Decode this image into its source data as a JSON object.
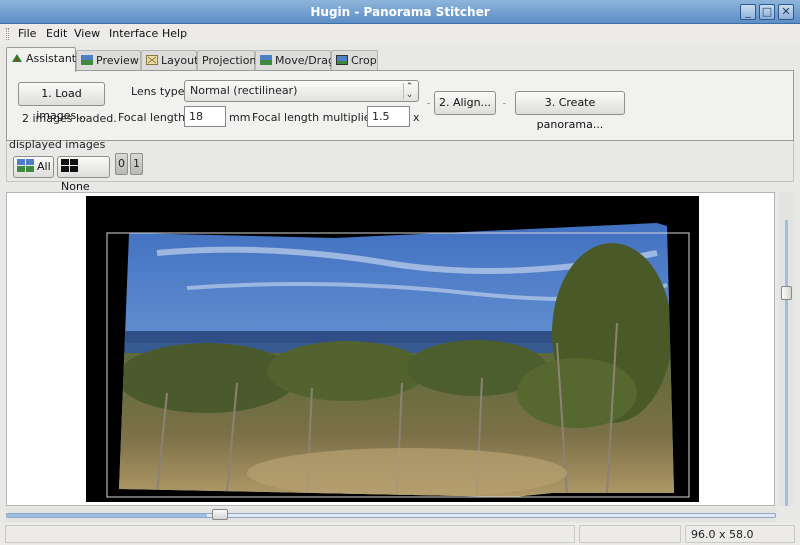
{
  "window": {
    "title": "Hugin - Panorama Stitcher",
    "controls": [
      "minimize-icon",
      "maximize-icon",
      "close-icon"
    ]
  },
  "menu": [
    "File",
    "Edit",
    "View",
    "Interface",
    "Help"
  ],
  "tabs": [
    {
      "label": "Assistant",
      "icon": "assistant-icon",
      "active": true
    },
    {
      "label": "Preview",
      "icon": "preview-icon",
      "active": false
    },
    {
      "label": "Layout",
      "icon": "layout-icon",
      "active": false
    },
    {
      "label": "Projection",
      "icon": "",
      "active": false
    },
    {
      "label": "Move/Drag",
      "icon": "move-drag-icon",
      "active": false
    },
    {
      "label": "Crop",
      "icon": "crop-icon",
      "active": false
    }
  ],
  "assistant": {
    "load_button": "1. Load images...",
    "status": "2 images loaded.",
    "lens_type_label": "Lens type:",
    "lens_type_value": "Normal (rectilinear)",
    "focal_length_label": "Focal length:",
    "focal_length_value": "18",
    "focal_length_unit": "mm",
    "multiplier_label": "Focal length multiplier:",
    "multiplier_value": "1.5",
    "multiplier_unit": "x",
    "align_button": "2. Align...",
    "create_button": "3. Create panorama..."
  },
  "displayed_images": {
    "heading": "displayed images",
    "all_button": "All",
    "none_button": "None",
    "image_buttons": [
      "0",
      "1"
    ]
  },
  "status": {
    "size": "96.0 x 58.0"
  },
  "colors": {
    "titlebar": "#6f9bd0",
    "sky": "#4e7fc6",
    "vegetation": "#5c6e35",
    "ground": "#a69064",
    "scroll_accent": "#9cbfe3"
  }
}
